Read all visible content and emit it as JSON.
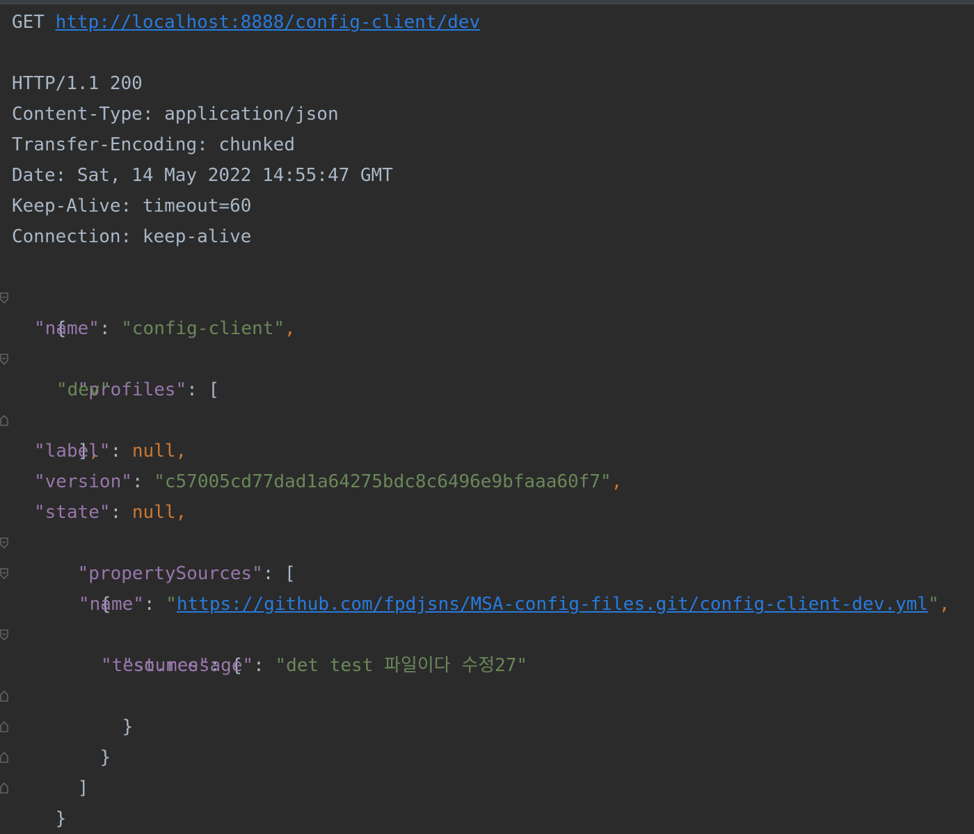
{
  "request": {
    "method": "GET",
    "url": "http://localhost:8888/config-client/dev"
  },
  "response": {
    "status_line": "HTTP/1.1 200",
    "headers": [
      "Content-Type: application/json",
      "Transfer-Encoding: chunked",
      "Date: Sat, 14 May 2022 14:55:47 GMT",
      "Keep-Alive: timeout=60",
      "Connection: keep-alive"
    ]
  },
  "body": {
    "name_key": "\"name\"",
    "name_value": "\"config-client\"",
    "profiles_key": "\"profiles\"",
    "profiles_item": "\"dev\"",
    "label_key": "\"label\"",
    "label_value": "null",
    "version_key": "\"version\"",
    "version_value": "\"c57005cd77dad1a64275bdc8c6496e9bfaaa60f7\"",
    "state_key": "\"state\"",
    "state_value": "null",
    "propertySources_key": "\"propertySources\"",
    "ps_name_key": "\"name\"",
    "ps_name_url": "https://github.com/fpdjsns/MSA-config-files.git/config-client-dev.yml",
    "ps_source_key": "\"source\"",
    "ps_msg_key": "\"test.message\"",
    "ps_msg_value": "\"det test 파일이다 수정27\""
  },
  "colors": {
    "background": "#2b2b2b",
    "text": "#a9b7c6",
    "json_key": "#9876aa",
    "json_string": "#6a8759",
    "json_keyword": "#cc7832",
    "link": "#287bde"
  }
}
